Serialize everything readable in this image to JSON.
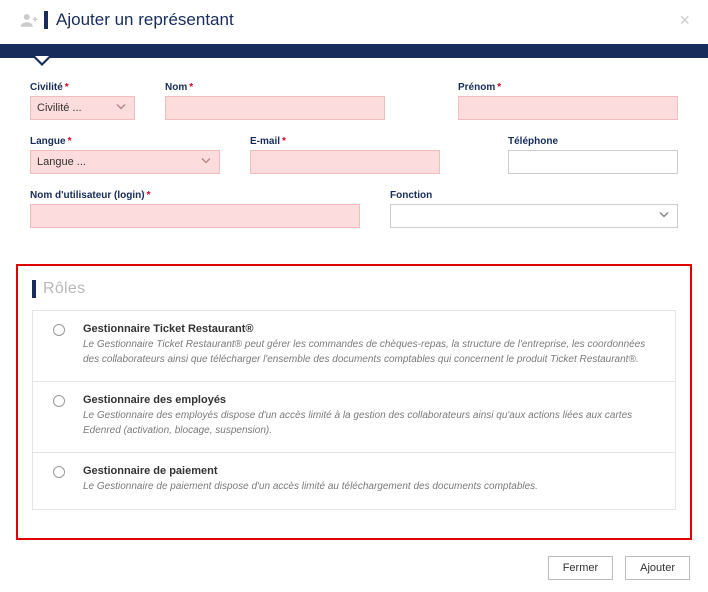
{
  "header": {
    "title": "Ajouter un représentant"
  },
  "fields": {
    "civilite": {
      "label": "Civilité",
      "placeholder": "Civilité ..."
    },
    "nom": {
      "label": "Nom"
    },
    "prenom": {
      "label": "Prénom"
    },
    "langue": {
      "label": "Langue",
      "placeholder": "Langue ..."
    },
    "email": {
      "label": "E-mail"
    },
    "telephone": {
      "label": "Téléphone"
    },
    "login": {
      "label": "Nom d'utilisateur (login)"
    },
    "fonction": {
      "label": "Fonction"
    }
  },
  "roles": {
    "heading": "Rôles",
    "items": [
      {
        "title": "Gestionnaire Ticket Restaurant®",
        "desc": "Le Gestionnaire Ticket Restaurant® peut gérer les commandes de chèques-repas, la structure de l'entreprise, les coordonnées des collaborateurs ainsi que télécharger l'ensemble des documents comptables qui concernent le produit Ticket Restaurant®."
      },
      {
        "title": "Gestionnaire des employés",
        "desc": "Le Gestionnaire des employés dispose d'un accès limité à la gestion des collaborateurs ainsi qu'aux actions liées aux cartes Edenred (activation, blocage, suspension)."
      },
      {
        "title": "Gestionnaire de paiement",
        "desc": "Le Gestionnaire de paiement dispose d'un accès limité au téléchargement des documents comptables."
      }
    ]
  },
  "footer": {
    "close": "Fermer",
    "submit": "Ajouter"
  }
}
